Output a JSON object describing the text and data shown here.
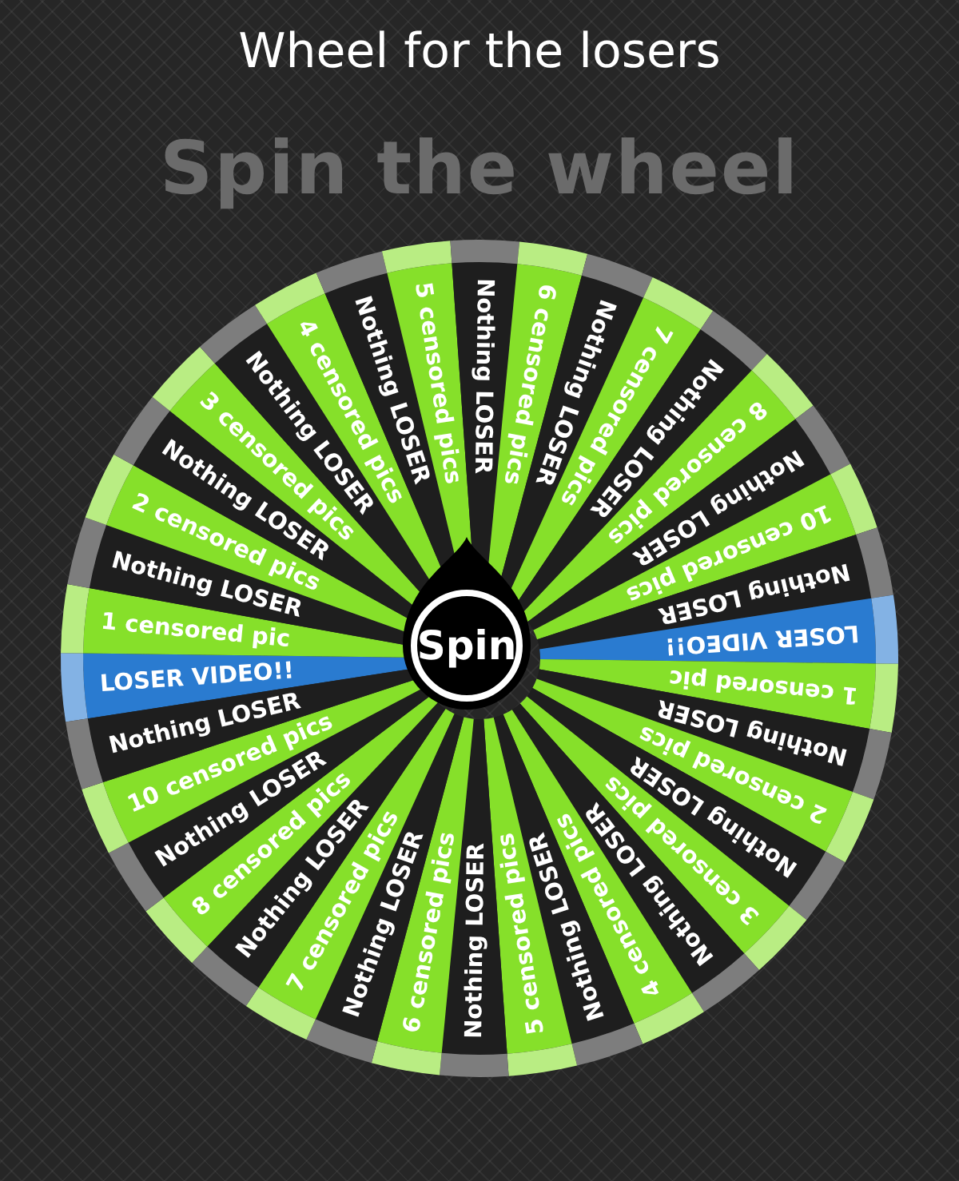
{
  "title": "Wheel for the losers",
  "heading": "Spin the wheel",
  "wheel": {
    "spin_label": "Spin",
    "segments": [
      {
        "label": "LOSER VIDEO!!",
        "color": "#2a7bd0"
      },
      {
        "label": "1 censored pic",
        "color": "#86e02a"
      },
      {
        "label": "Nothing LOSER",
        "color": "#1e1e1e"
      },
      {
        "label": "2 censored pics",
        "color": "#86e02a"
      },
      {
        "label": "Nothing LOSER",
        "color": "#1e1e1e"
      },
      {
        "label": "3 censored pics",
        "color": "#86e02a"
      },
      {
        "label": "Nothing LOSER",
        "color": "#1e1e1e"
      },
      {
        "label": "4 censored pics",
        "color": "#86e02a"
      },
      {
        "label": "Nothing LOSER",
        "color": "#1e1e1e"
      },
      {
        "label": "5 censored pics",
        "color": "#86e02a"
      },
      {
        "label": "Nothing LOSER",
        "color": "#1e1e1e"
      },
      {
        "label": "6 censored pics",
        "color": "#86e02a"
      },
      {
        "label": "Nothing LOSER",
        "color": "#1e1e1e"
      },
      {
        "label": "7 censored pics",
        "color": "#86e02a"
      },
      {
        "label": "Nothing LOSER",
        "color": "#1e1e1e"
      },
      {
        "label": "8 censored pics",
        "color": "#86e02a"
      },
      {
        "label": "Nothing LOSER",
        "color": "#1e1e1e"
      },
      {
        "label": "10 censored pics",
        "color": "#86e02a"
      },
      {
        "label": "Nothing LOSER",
        "color": "#1e1e1e"
      },
      {
        "label": "LOSER VIDEO!!",
        "color": "#2a7bd0"
      },
      {
        "label": "1 censored pic",
        "color": "#86e02a"
      },
      {
        "label": "Nothing LOSER",
        "color": "#1e1e1e"
      },
      {
        "label": "2 censored pics",
        "color": "#86e02a"
      },
      {
        "label": "Nothing LOSER",
        "color": "#1e1e1e"
      },
      {
        "label": "3 censored pics",
        "color": "#86e02a"
      },
      {
        "label": "Nothing LOSER",
        "color": "#1e1e1e"
      },
      {
        "label": "4 censored pics",
        "color": "#86e02a"
      },
      {
        "label": "Nothing LOSER",
        "color": "#1e1e1e"
      },
      {
        "label": "5 censored pics",
        "color": "#86e02a"
      },
      {
        "label": "Nothing LOSER",
        "color": "#1e1e1e"
      },
      {
        "label": "6 censored pics",
        "color": "#86e02a"
      },
      {
        "label": "Nothing LOSER",
        "color": "#1e1e1e"
      },
      {
        "label": "7 censored pics",
        "color": "#86e02a"
      },
      {
        "label": "Nothing LOSER",
        "color": "#1e1e1e"
      },
      {
        "label": "8 censored pics",
        "color": "#86e02a"
      },
      {
        "label": "Nothing LOSER",
        "color": "#1e1e1e"
      },
      {
        "label": "10 censored pics",
        "color": "#86e02a"
      },
      {
        "label": "Nothing LOSER",
        "color": "#1e1e1e"
      }
    ]
  }
}
